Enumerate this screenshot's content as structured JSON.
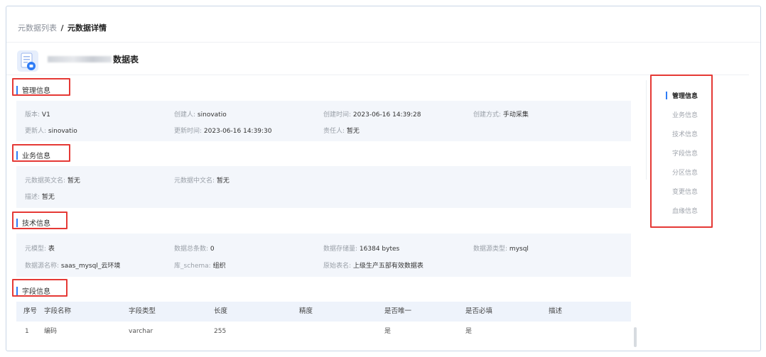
{
  "breadcrumb": {
    "parent": "元数据列表",
    "separator": "/",
    "current": "元数据详情"
  },
  "table": {
    "name_suffix": "数据表"
  },
  "sections": {
    "manage": {
      "title": "管理信息",
      "items": [
        {
          "k": "版本:",
          "v": "V1"
        },
        {
          "k": "创建人:",
          "v": "sinovatio"
        },
        {
          "k": "创建时间:",
          "v": "2023-06-16 14:39:28"
        },
        {
          "k": "创建方式:",
          "v": "手动采集"
        },
        {
          "k": "更新人:",
          "v": "sinovatio"
        },
        {
          "k": "更新时间:",
          "v": "2023-06-16 14:39:30"
        },
        {
          "k": "责任人:",
          "v": "暂无"
        }
      ]
    },
    "business": {
      "title": "业务信息",
      "items": [
        {
          "k": "元数据英文名:",
          "v": "暂无"
        },
        {
          "k": "元数据中文名:",
          "v": "暂无"
        },
        {
          "k": "描述:",
          "v": "暂无"
        }
      ]
    },
    "tech": {
      "title": "技术信息",
      "items": [
        {
          "k": "元模型:",
          "v": "表"
        },
        {
          "k": "数据总条数:",
          "v": "0"
        },
        {
          "k": "数据存储量:",
          "v": "16384 bytes"
        },
        {
          "k": "数据源类型:",
          "v": "mysql"
        },
        {
          "k": "数据源名称:",
          "v": "saas_mysql_云环境"
        },
        {
          "k": "库_schema:",
          "v": "组织"
        },
        {
          "k": "原始表名:",
          "v": "上级生产五部有效数据表"
        }
      ]
    },
    "fields": {
      "title": "字段信息",
      "columns": [
        "序号",
        "字段名称",
        "字段类型",
        "长度",
        "精度",
        "是否唯一",
        "是否必填",
        "描述"
      ],
      "rows": [
        [
          "1",
          "编码",
          "varchar",
          "255",
          "",
          "是",
          "是",
          ""
        ]
      ]
    }
  },
  "anchor_nav": [
    "管理信息",
    "业务信息",
    "技术信息",
    "字段信息",
    "分区信息",
    "变更信息",
    "血缘信息"
  ],
  "colors": {
    "accent": "#2f7cf6",
    "highlight_box": "#e53935",
    "panel_bg": "#f3f6fb"
  }
}
